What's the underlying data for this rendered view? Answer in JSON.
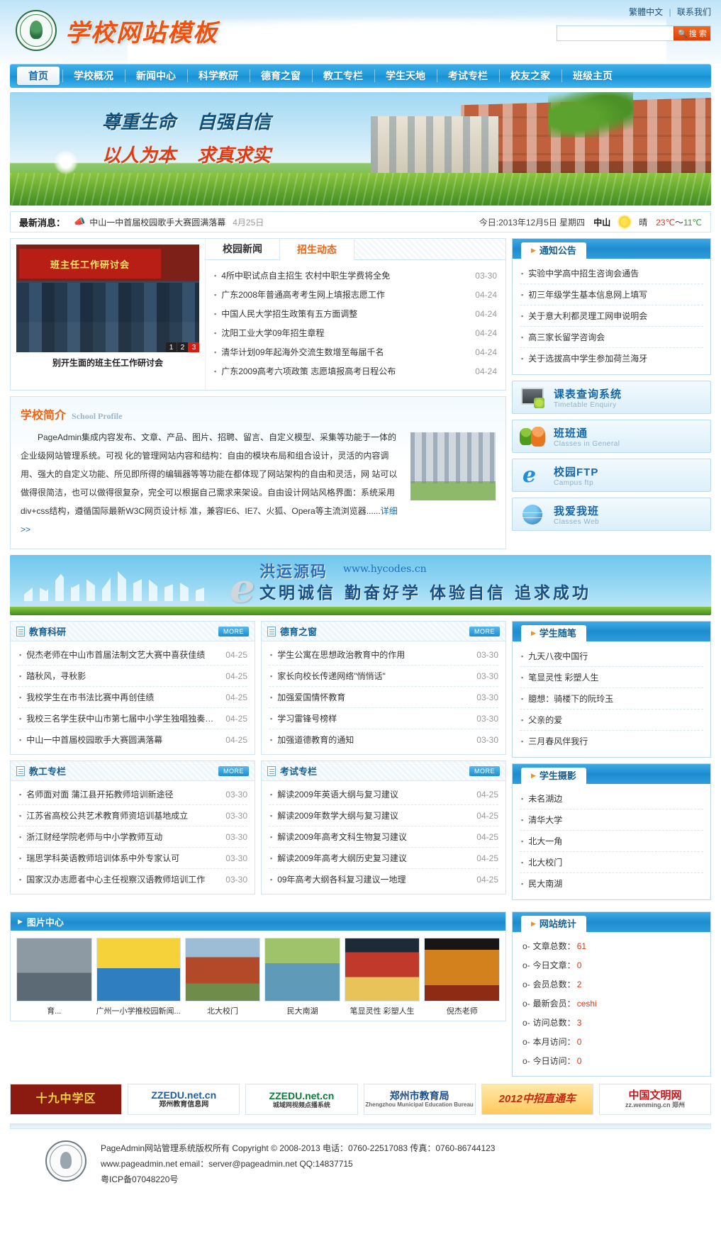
{
  "header": {
    "top_links": [
      {
        "label": "繁體中文"
      },
      {
        "label": "联系我们"
      }
    ],
    "site_title": "学校网站模板",
    "search": {
      "value": "",
      "placeholder": "",
      "button_label": "搜 索",
      "icon": "search-icon"
    }
  },
  "nav": {
    "items": [
      {
        "label": "首页",
        "active": true
      },
      {
        "label": "学校概况",
        "active": false
      },
      {
        "label": "新闻中心",
        "active": false
      },
      {
        "label": "科学教研",
        "active": false
      },
      {
        "label": "德育之窗",
        "active": false
      },
      {
        "label": "教工专栏",
        "active": false
      },
      {
        "label": "学生天地",
        "active": false
      },
      {
        "label": "考试专栏",
        "active": false
      },
      {
        "label": "校友之家",
        "active": false
      },
      {
        "label": "班级主页",
        "active": false
      }
    ]
  },
  "banner": {
    "slogans": [
      "尊重生命",
      "自强自信",
      "以人为本",
      "求真求实"
    ]
  },
  "ticker": {
    "label": "最新消息：",
    "icon": "megaphone-icon",
    "text": "中山一中首届校园歌手大赛圆满落幕",
    "date": "4月25日",
    "today": "今日:2013年12月5日 星期四",
    "city": "中山",
    "weather_icon": "sun-icon",
    "weather": "晴",
    "high": "23℃",
    "tilde": "～",
    "low": "11℃"
  },
  "slideshow": {
    "banner_text": "班主任工作研讨会",
    "caption": "别开生面的班主任工作研讨会",
    "pager": [
      {
        "label": "1",
        "active": false
      },
      {
        "label": "2",
        "active": false
      },
      {
        "label": "3",
        "active": true
      }
    ]
  },
  "news": {
    "tabs": [
      {
        "label": "校园新闻",
        "active": false
      },
      {
        "label": "招生动态",
        "active": true
      }
    ],
    "items": [
      {
        "title": "4所中职试点自主招生 农村中职生学费将全免",
        "date": "03-30"
      },
      {
        "title": "广东2008年普通高考考生网上填报志愿工作",
        "date": "04-24"
      },
      {
        "title": "中国人民大学招生政策有五方面调整",
        "date": "04-24"
      },
      {
        "title": "沈阳工业大学09年招生章程",
        "date": "04-24"
      },
      {
        "title": "清华计划09年起海外交流生数增至每届千名",
        "date": "04-24"
      },
      {
        "title": "广东2009高考六项政策 志愿填报高考日程公布",
        "date": "04-24"
      }
    ]
  },
  "notices": {
    "title": "通知公告",
    "items": [
      {
        "title": "实验中学高中招生咨询会通告"
      },
      {
        "title": "初三年级学生基本信息网上填写"
      },
      {
        "title": "关于意大利都灵理工网申说明会"
      },
      {
        "title": "高三家长留学咨询会"
      },
      {
        "title": "关于选拔高中学生参加荷兰海牙"
      }
    ]
  },
  "quick_buttons": [
    {
      "cn": "课表查询系统",
      "en": "Timetable Enquiry",
      "icon": "monitor-icon"
    },
    {
      "cn": "班班通",
      "en": "Classes in General",
      "icon": "people-icon"
    },
    {
      "cn": "校园FTP",
      "en": "Campus ftp",
      "icon": "explorer-e-icon"
    },
    {
      "cn": "我爱我班",
      "en": "Classes Web",
      "icon": "globe-icon"
    }
  ],
  "profile": {
    "title_cn": "学校简介",
    "title_en": "School Profile",
    "text": "PageAdmin集成内容发布、文章、产品、图片、招聘、留言、自定义模型、采集等功能于一体的企业级网站管理系统。可视 化的管理网站内容和结构：自由的模块布局和组合设计，灵活的内容调用、强大的自定义功能、所见即所得的编辑器等等功能在都体现了网站架构的自由和灵活，网 站可以做得很简洁，也可以做得很复杂，完全可以根据自己需求来架设。自由设计网站风格界面：系统采用div+css结构，遵循国际最新W3C网页设计标 准，兼容IE6、IE7、火狐、Opera等主流浏览器......",
    "more_label": "详细>>"
  },
  "midbanner": {
    "brand": "洪运源码",
    "url": "www.hycodes.cn",
    "slogan": "文明诚信  勤奋好学  体验自信  追求成功"
  },
  "sections": [
    {
      "title": "教育科研",
      "more": "MORE",
      "items": [
        {
          "title": "倪杰老师在中山市首届法制文艺大赛中喜获佳绩",
          "date": "04-25"
        },
        {
          "title": "踏秋风，寻秋影",
          "date": "04-25"
        },
        {
          "title": "我校学生在市书法比赛中再创佳绩",
          "date": "04-25"
        },
        {
          "title": "我校三名学生获中山市第七届中小学生独唱独奏比赛...",
          "date": "04-25"
        },
        {
          "title": "中山一中首届校园歌手大赛圆满落幕",
          "date": "04-25"
        }
      ]
    },
    {
      "title": "德育之窗",
      "more": "MORE",
      "items": [
        {
          "title": "学生公寓在思想政治教育中的作用",
          "date": "03-30"
        },
        {
          "title": "家长向校长传递网络\"悄悄话\"",
          "date": "03-30"
        },
        {
          "title": "加强爱国情怀教育",
          "date": "03-30"
        },
        {
          "title": "学习雷锋号榜样",
          "date": "03-30"
        },
        {
          "title": "加强道德教育的通知",
          "date": "03-30"
        }
      ]
    },
    {
      "title": "教工专栏",
      "more": "MORE",
      "items": [
        {
          "title": "名师面对面 蒲江县开拓教师培训新途径",
          "date": "03-30"
        },
        {
          "title": "江苏省高校公共艺术教育师资培训基地成立",
          "date": "03-30"
        },
        {
          "title": "浙江财经学院老师与中小学教师互动",
          "date": "03-30"
        },
        {
          "title": "瑞思学科英语教师培训体系中外专家认可",
          "date": "03-30"
        },
        {
          "title": "国家汉办志愿者中心主任视察汉语教师培训工作",
          "date": "03-30"
        }
      ]
    },
    {
      "title": "考试专栏",
      "more": "MORE",
      "items": [
        {
          "title": "解读2009年英语大纲与复习建议",
          "date": "04-25"
        },
        {
          "title": "解读2009年数学大纲与复习建议",
          "date": "04-25"
        },
        {
          "title": "解读2009年高考文科生物复习建议",
          "date": "04-25"
        },
        {
          "title": "解读2009年高考大纲历史复习建议",
          "date": "04-25"
        },
        {
          "title": "09年高考大纲各科复习建议一地理",
          "date": "04-25"
        }
      ]
    }
  ],
  "student_panels": [
    {
      "title": "学生随笔",
      "items": [
        {
          "title": "九天八夜中国行"
        },
        {
          "title": "笔显灵性 彩塑人生"
        },
        {
          "title": "臆想：骑楼下的阮玲玉"
        },
        {
          "title": "父亲的爱"
        },
        {
          "title": "三月春风伴我行"
        }
      ]
    },
    {
      "title": "学生摄影",
      "items": [
        {
          "title": "未名湖边"
        },
        {
          "title": "清华大学"
        },
        {
          "title": "北大一角"
        },
        {
          "title": "北大校门"
        },
        {
          "title": "民大南湖"
        }
      ]
    }
  ],
  "photo_center": {
    "title": "图片中心",
    "items": [
      {
        "caption": "育..."
      },
      {
        "caption": "广州一小学推校园新闻..."
      },
      {
        "caption": "北大校门"
      },
      {
        "caption": "民大南湖"
      },
      {
        "caption": "笔显灵性 彩塑人生"
      },
      {
        "caption": "倪杰老师"
      }
    ]
  },
  "stats": {
    "title": "网站统计",
    "items": [
      {
        "label": "文章总数：",
        "value": "61"
      },
      {
        "label": "今日文章：",
        "value": "0"
      },
      {
        "label": "会员总数：",
        "value": "2"
      },
      {
        "label": "最新会员：",
        "value": "ceshi"
      },
      {
        "label": "访问总数：",
        "value": "3"
      },
      {
        "label": "本月访问：",
        "value": "0"
      },
      {
        "label": "今日访问：",
        "value": "0"
      }
    ]
  },
  "friend_links": [
    {
      "style": "lk1",
      "big": "十九中学区",
      "sm": ""
    },
    {
      "style": "lk2",
      "big": "ZZEDU.net.cn",
      "sm": "郑州教育信息网"
    },
    {
      "style": "lk3",
      "big": "ZZEDU.net.cn",
      "sm": "城域网视频点播系统"
    },
    {
      "style": "lk4",
      "big": "郑州市教育局",
      "sm": "Zhengzhou Municipal Education Bureau"
    },
    {
      "style": "lk5",
      "big": "2012中招直通车",
      "sm": ""
    },
    {
      "style": "lk6",
      "big": "中国文明网",
      "sm": "zz.wenming.cn    郑州"
    }
  ],
  "footer": {
    "line1": "PageAdmin网站管理系统版权所有  Copyright © 2008-2013    电话：0760-22517083  传真：0760-86744123",
    "line2": "www.pageadmin.net  email：server@pageadmin.net  QQ:14837715",
    "line3": "粤ICP备07048220号"
  }
}
